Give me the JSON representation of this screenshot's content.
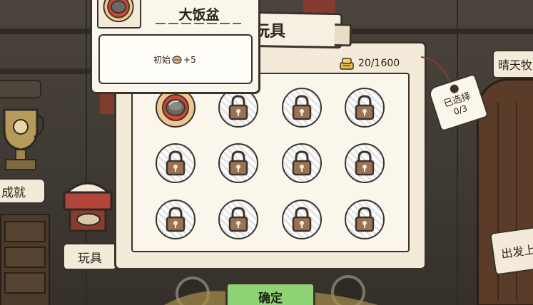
{
  "panel": {
    "title": "玩具",
    "coin_icon": "coin-stack-icon",
    "coin_count": "20/1600"
  },
  "selection_tag": {
    "label": "已选择",
    "count": "0/3"
  },
  "popup": {
    "item_name": "大饭盆",
    "item_icon": "food-bowl-icon",
    "desc_prefix": "初始",
    "desc_icon": "dried-fish-icon",
    "desc_suffix": "+5"
  },
  "grid": {
    "slots": [
      {
        "state": "owned",
        "icon": "food-bowl-icon"
      },
      {
        "state": "locked",
        "icon": "padlock-icon"
      },
      {
        "state": "locked",
        "icon": "padlock-icon"
      },
      {
        "state": "locked",
        "icon": "padlock-icon"
      },
      {
        "state": "locked",
        "icon": "padlock-icon"
      },
      {
        "state": "locked",
        "icon": "padlock-icon"
      },
      {
        "state": "locked",
        "icon": "padlock-icon"
      },
      {
        "state": "locked",
        "icon": "padlock-icon"
      },
      {
        "state": "locked",
        "icon": "padlock-icon"
      },
      {
        "state": "locked",
        "icon": "padlock-icon"
      },
      {
        "state": "locked",
        "icon": "padlock-icon"
      },
      {
        "state": "locked",
        "icon": "padlock-icon"
      }
    ]
  },
  "background": {
    "achievement_label": "成就",
    "toy_label": "玩具",
    "weather_label": "晴天牧",
    "depart_label": "出发上"
  },
  "confirm": {
    "label": "确定"
  },
  "colors": {
    "confirm_green": "#8ed275",
    "owned_slot": "#f1c58d",
    "panel_bg": "#f3ead9",
    "outline": "#3a332c"
  }
}
